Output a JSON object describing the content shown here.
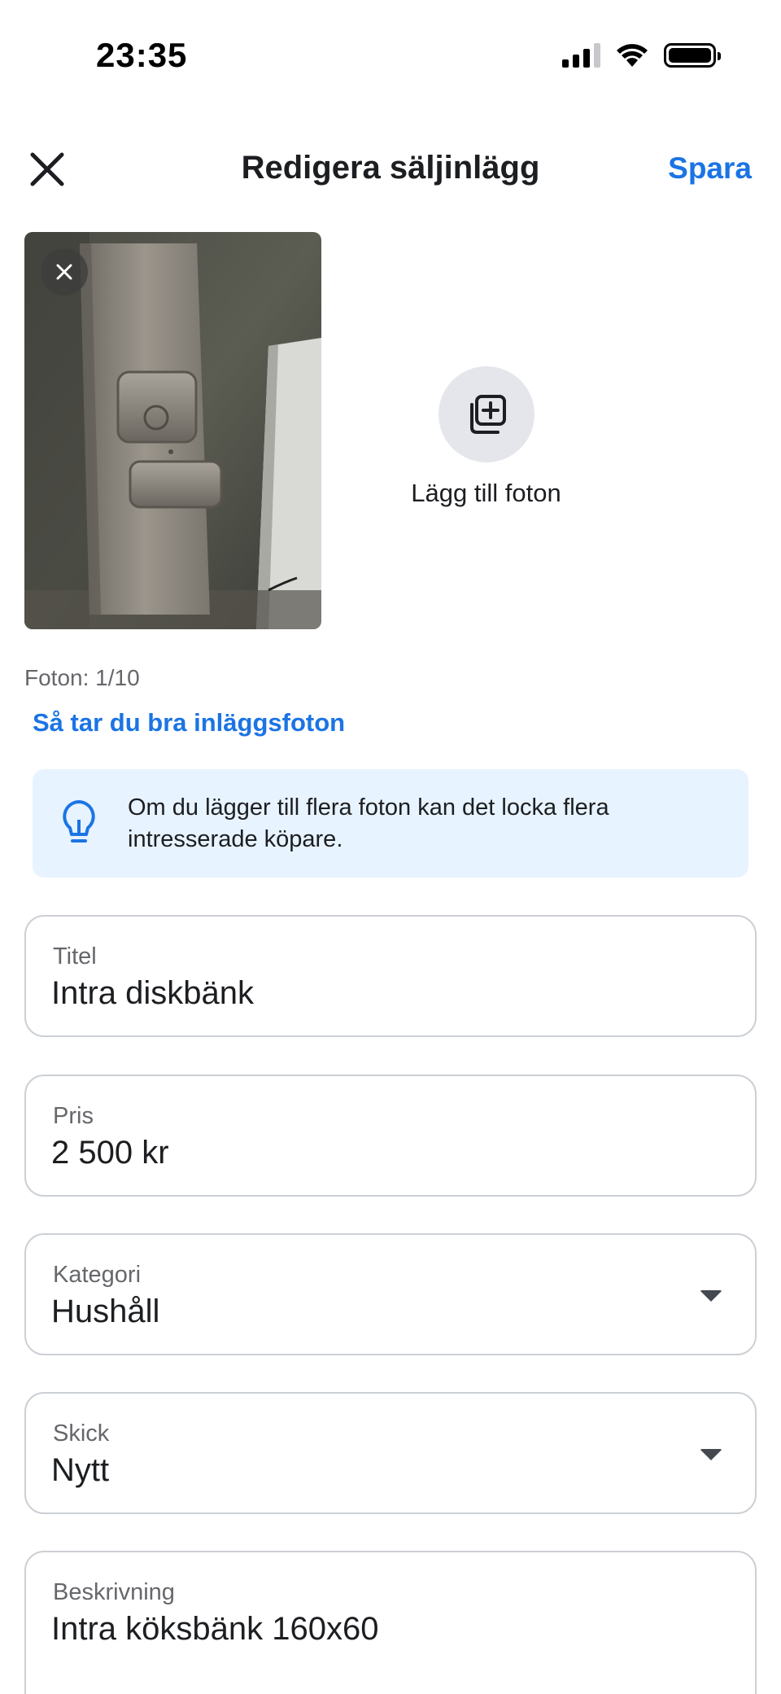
{
  "status_bar": {
    "time": "23:35",
    "icons": [
      "cellular-signal-icon",
      "wifi-icon",
      "battery-icon"
    ]
  },
  "header": {
    "title": "Redigera säljinlägg",
    "save_label": "Spara",
    "close_icon": "close-icon"
  },
  "photos": {
    "add_label": "Lägg till foton",
    "count_text": "Foton: 1/10",
    "tips_link": "Så tar du bra inläggsfoton"
  },
  "info_banner": {
    "icon": "lightbulb-icon",
    "text": "Om du lägger till flera foton kan det locka flera intresserade köpare."
  },
  "form": {
    "title": {
      "label": "Titel",
      "value": "Intra diskbänk"
    },
    "price": {
      "label": "Pris",
      "value": "2 500 kr"
    },
    "category": {
      "label": "Kategori",
      "value": "Hushåll"
    },
    "condition": {
      "label": "Skick",
      "value": "Nytt"
    },
    "description": {
      "label": "Beskrivning",
      "value": "Intra köksbänk 160x60"
    }
  },
  "colors": {
    "accent": "#1b74e4",
    "banner_bg": "#e7f3ff",
    "border": "#ccd0d5",
    "secondary_text": "#65676b"
  }
}
